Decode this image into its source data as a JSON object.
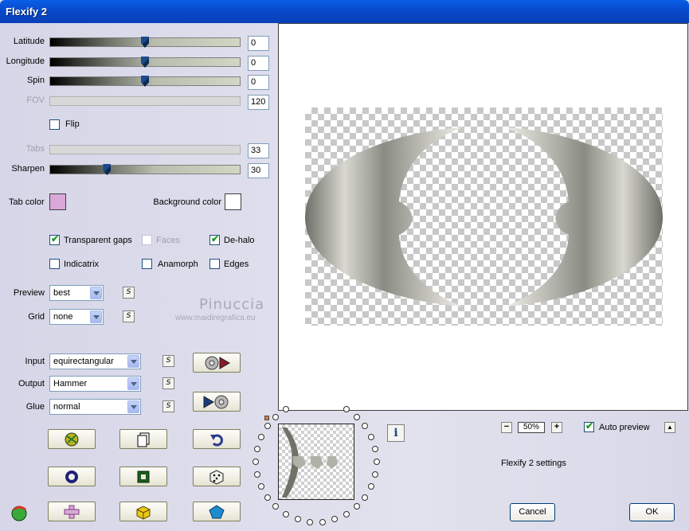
{
  "window": {
    "title": "Flexify 2"
  },
  "sliders": [
    {
      "label": "Latitude",
      "value": "0",
      "level": 0.5,
      "enabled": true
    },
    {
      "label": "Longitude",
      "value": "0",
      "level": 0.5,
      "enabled": true
    },
    {
      "label": "Spin",
      "value": "0",
      "level": 0.5,
      "enabled": true
    },
    {
      "label": "FOV",
      "value": "120",
      "enabled": false
    },
    {
      "label": "Tabs",
      "value": "33",
      "enabled": false
    },
    {
      "label": "Sharpen",
      "value": "30",
      "level": 0.3,
      "enabled": true
    }
  ],
  "flip": {
    "label": "Flip",
    "checked": false
  },
  "tab_color": {
    "label": "Tab color",
    "color": "#d9a8d9"
  },
  "background_color": {
    "label": "Background color",
    "color": "#ffffff"
  },
  "options": {
    "transparent_gaps": {
      "label": "Transparent gaps",
      "checked": true
    },
    "faces": {
      "label": "Faces",
      "checked": false,
      "enabled": false
    },
    "de_halo": {
      "label": "De-halo",
      "checked": true
    },
    "indicatrix": {
      "label": "Indicatrix",
      "checked": false
    },
    "anamorph": {
      "label": "Anamorph",
      "checked": false
    },
    "edges": {
      "label": "Edges",
      "checked": false
    }
  },
  "preview_select": {
    "label": "Preview",
    "value": "best"
  },
  "grid_select": {
    "label": "Grid",
    "value": "none"
  },
  "input_select": {
    "label": "Input",
    "value": "equirectangular"
  },
  "output_select": {
    "label": "Output",
    "value": "Hammer"
  },
  "glue_select": {
    "label": "Glue",
    "value": "normal"
  },
  "s_button_label": "S",
  "watermark": {
    "name": "Pinuccia",
    "url": "www.maidiregrafica.eu"
  },
  "zoom": {
    "value": "50%",
    "minus": "−",
    "plus": "+"
  },
  "auto_preview": {
    "label": "Auto preview",
    "checked": true
  },
  "settings_label": "Flexify 2 settings",
  "info_label": "i",
  "buttons": {
    "cancel": "Cancel",
    "ok": "OK"
  },
  "icons": {
    "render_to_globe": "globe-play-icon",
    "render_from_globe": "play-globe-icon",
    "randomize": "dice-icon",
    "undo": "undo-arrow-icon",
    "copy": "copy-pages-icon",
    "presets": "preset-icon"
  }
}
